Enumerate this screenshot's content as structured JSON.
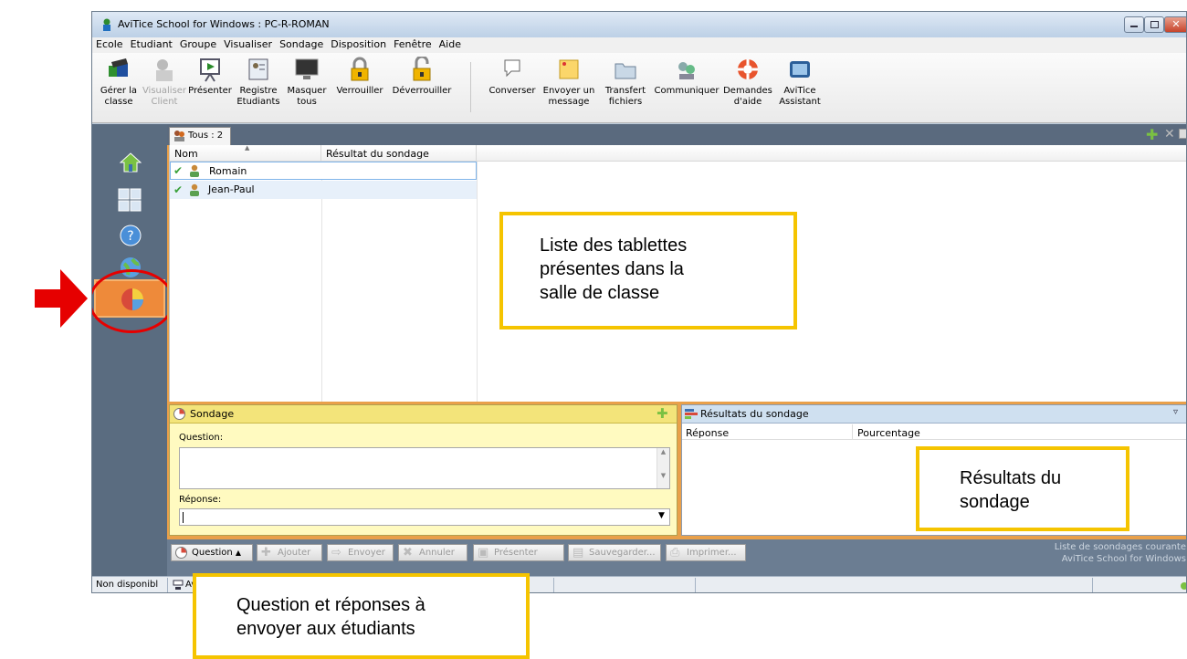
{
  "window": {
    "title": "AviTice School for Windows : PC-R-ROMAN"
  },
  "menu": [
    "Ecole",
    "Etudiant",
    "Groupe",
    "Visualiser",
    "Sondage",
    "Disposition",
    "Fenêtre",
    "Aide"
  ],
  "toolbar": {
    "gerer": [
      "Gérer la",
      "classe"
    ],
    "visualiser": [
      "Visualiser",
      "Client"
    ],
    "presenter": [
      "Présenter",
      ""
    ],
    "registre": [
      "Registre",
      "Etudiants"
    ],
    "masquer": [
      "Masquer",
      "tous"
    ],
    "verrouiller": [
      "Verrouiller",
      ""
    ],
    "deverrouiller": [
      "Déverrouiller",
      ""
    ],
    "converser": [
      "Converser",
      ""
    ],
    "envoyer": [
      "Envoyer un",
      "message"
    ],
    "transfert": [
      "Transfert",
      "fichiers"
    ],
    "communiquer": [
      "Communiquer",
      ""
    ],
    "demandes": [
      "Demandes",
      "d'aide"
    ],
    "assistant": [
      "AviTice",
      "Assistant"
    ]
  },
  "tab_label": "Tous : 2",
  "list": {
    "columns": [
      "Nom",
      "Résultat du sondage"
    ],
    "rows": [
      "Romain",
      "Jean-Paul"
    ]
  },
  "sondage": {
    "title": "Sondage",
    "question_label": "Question:",
    "reponse_label": "Réponse:"
  },
  "results": {
    "title": "Résultats du sondage",
    "columns": [
      "Réponse",
      "Pourcentage"
    ]
  },
  "buttons": {
    "question": "Question",
    "ajouter": "Ajouter",
    "envoyer": "Envoyer",
    "annuler": "Annuler",
    "presenter": "Présenter",
    "sauvegarder": "Sauvegarder...",
    "imprimer": "Imprimer..."
  },
  "bottom_right": [
    "Liste de soondages courante",
    "AviTice School for Windows"
  ],
  "status": {
    "left": "Non disponibl",
    "second": "Av"
  },
  "callouts": {
    "list": [
      "Liste des tablettes",
      "présentes dans la",
      "salle de classe"
    ],
    "results": [
      "Résultats du",
      "sondage"
    ],
    "question": [
      "Question et réponses à",
      "envoyer aux étudiants"
    ]
  },
  "colors": {
    "accent": "#f5c400",
    "arrow": "#e60000",
    "orange": "#e9a04a"
  }
}
